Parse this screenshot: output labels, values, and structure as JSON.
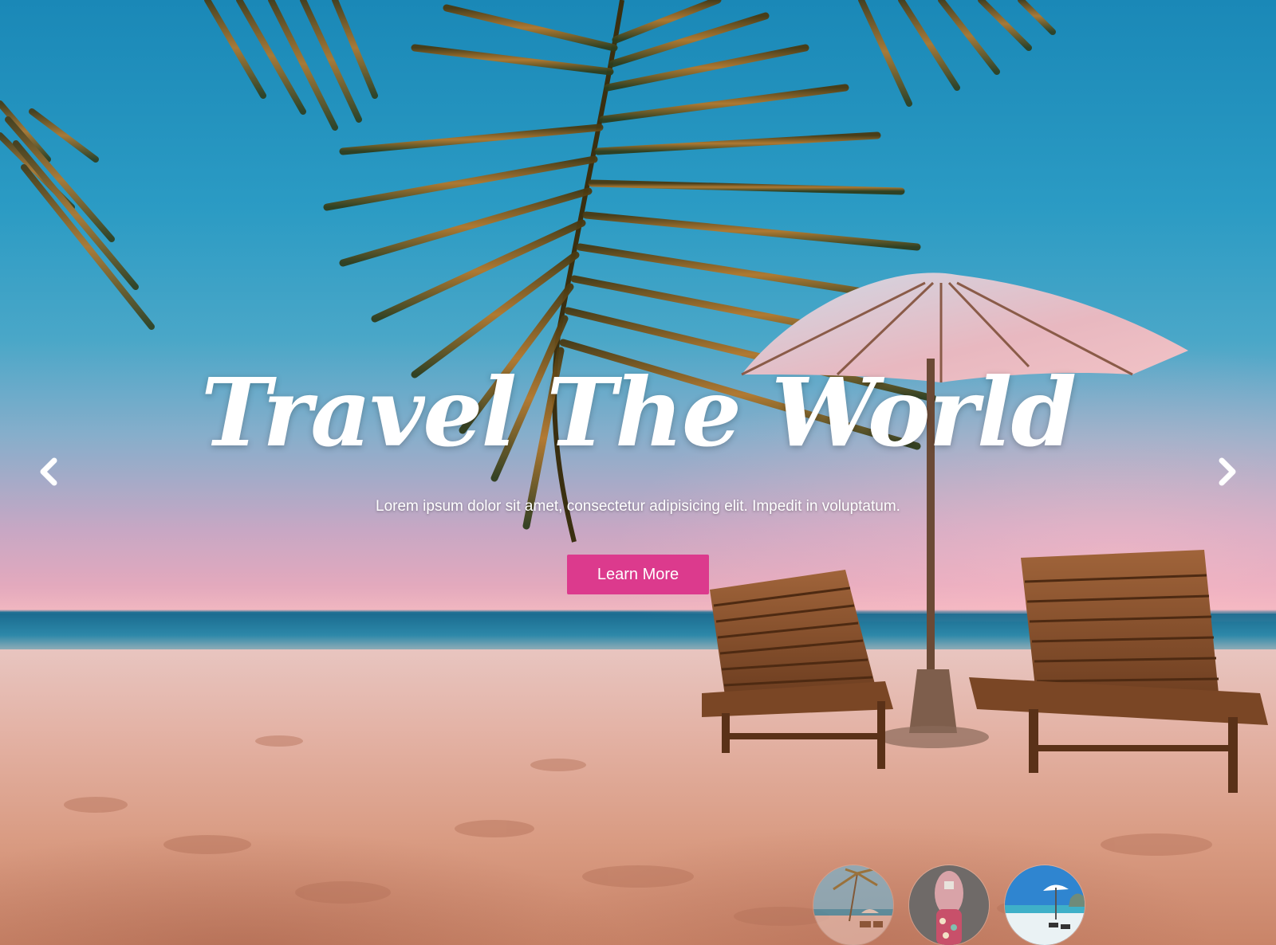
{
  "hero": {
    "title": "Travel The World",
    "subtitle": "Lorem ipsum dolor sit amet, consectetur adipisicing elit. Impedit in voluptatum.",
    "cta_label": "Learn More"
  },
  "slider": {
    "prev_icon": "chevron-left-icon",
    "next_icon": "chevron-right-icon",
    "thumbnails": [
      {
        "name": "thumbnail-beach-palm",
        "active": false
      },
      {
        "name": "thumbnail-shoes",
        "active": false
      },
      {
        "name": "thumbnail-beach-umbrella",
        "active": true
      }
    ]
  },
  "colors": {
    "cta_background": "#dc3a8d",
    "text": "#ffffff"
  }
}
